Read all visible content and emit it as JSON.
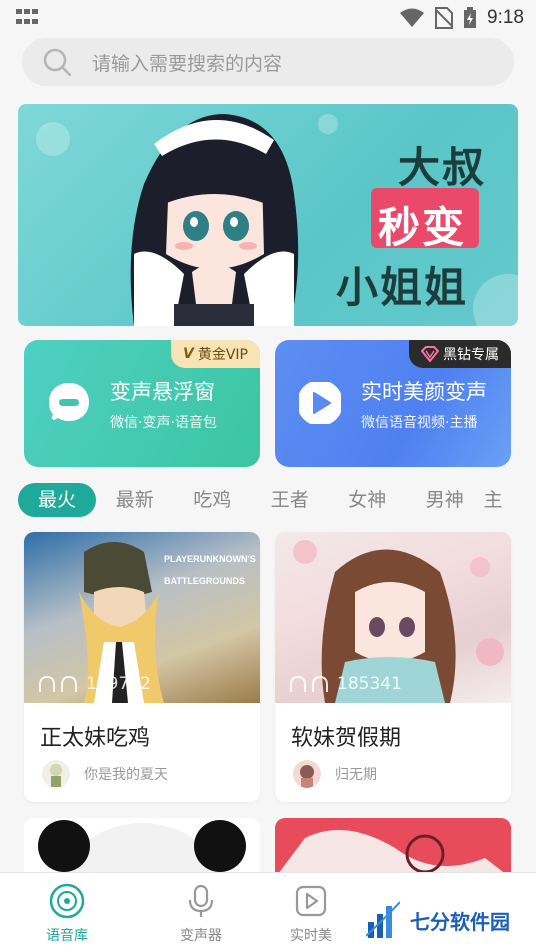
{
  "status_bar": {
    "time": "9:18"
  },
  "search": {
    "placeholder": "请输入需要搜索的内容"
  },
  "banner": {
    "line1": "大叔",
    "line2": "秒变",
    "line3": "小姐姐"
  },
  "features": [
    {
      "title": "变声悬浮窗",
      "subtitle": "微信·变声·语音包",
      "badge": "黄金VIP"
    },
    {
      "title": "实时美颜变声",
      "subtitle": "微信语音视频·主播",
      "badge": "黑钻专属"
    }
  ],
  "tabs": [
    "最火",
    "最新",
    "吃鸡",
    "王者",
    "女神",
    "男神",
    "主"
  ],
  "cards": [
    {
      "title": "正太妹吃鸡",
      "plays": "189712",
      "username": "你是我的夏天",
      "image_text": "PLAYERUNKNOWN'S BATTLEGROUNDS"
    },
    {
      "title": "软妹贺假期",
      "plays": "185341",
      "username": "归无期"
    }
  ],
  "bottom_nav": [
    {
      "label": "语音库",
      "active": true
    },
    {
      "label": "变声器",
      "active": false
    },
    {
      "label": "实时美",
      "active": false
    }
  ],
  "watermark": {
    "text": "七分软件园"
  },
  "colors": {
    "accent": "#1ea99b",
    "banner_red": "#ea4969"
  }
}
